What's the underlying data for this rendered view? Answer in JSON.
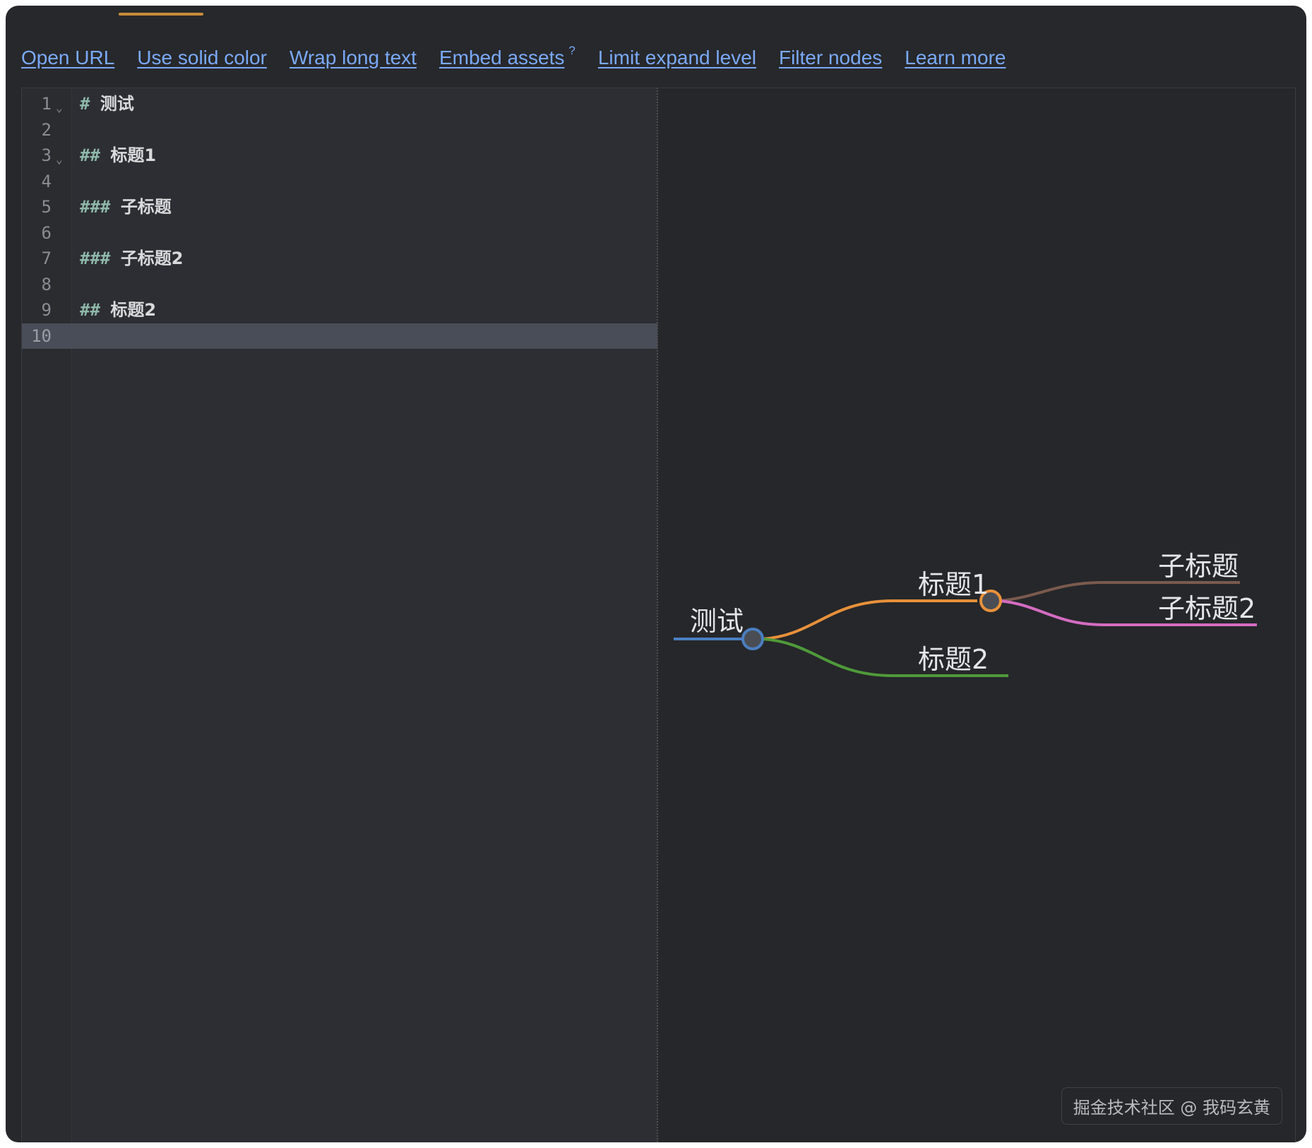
{
  "toolbar": {
    "links": [
      {
        "label": "Open URL"
      },
      {
        "label": "Use solid color"
      },
      {
        "label": "Wrap long text"
      },
      {
        "label": "Embed assets",
        "sup": "?"
      },
      {
        "label": "Limit expand level"
      },
      {
        "label": "Filter nodes"
      },
      {
        "label": "Learn more"
      }
    ]
  },
  "editor": {
    "lines": [
      {
        "num": "1",
        "marker": "#",
        "text": "测试",
        "fold": true
      },
      {
        "num": "2",
        "marker": "",
        "text": ""
      },
      {
        "num": "3",
        "marker": "##",
        "text": "标题1",
        "fold": true
      },
      {
        "num": "4",
        "marker": "",
        "text": ""
      },
      {
        "num": "5",
        "marker": "###",
        "text": "子标题"
      },
      {
        "num": "6",
        "marker": "",
        "text": ""
      },
      {
        "num": "7",
        "marker": "###",
        "text": "子标题2"
      },
      {
        "num": "8",
        "marker": "",
        "text": ""
      },
      {
        "num": "9",
        "marker": "##",
        "text": "标题2"
      },
      {
        "num": "10",
        "marker": "",
        "text": "",
        "active": true
      }
    ],
    "fold_icon": "chevron-down-icon"
  },
  "mindmap": {
    "root": {
      "label": "测试",
      "color": "#4a7fc1"
    },
    "h1": {
      "label": "标题1",
      "color": "#e8913a"
    },
    "h2": {
      "label": "标题2",
      "color": "#4f9a3a"
    },
    "sub1": {
      "label": "子标题",
      "color": "#7a5a4e"
    },
    "sub2": {
      "label": "子标题2",
      "color": "#d46cc2"
    }
  },
  "watermark": "掘金技术社区 @ 我码玄黄",
  "colors": {
    "link": "#7aa9f7",
    "tab_indicator": "#c98b3c",
    "background": "#27282b"
  }
}
